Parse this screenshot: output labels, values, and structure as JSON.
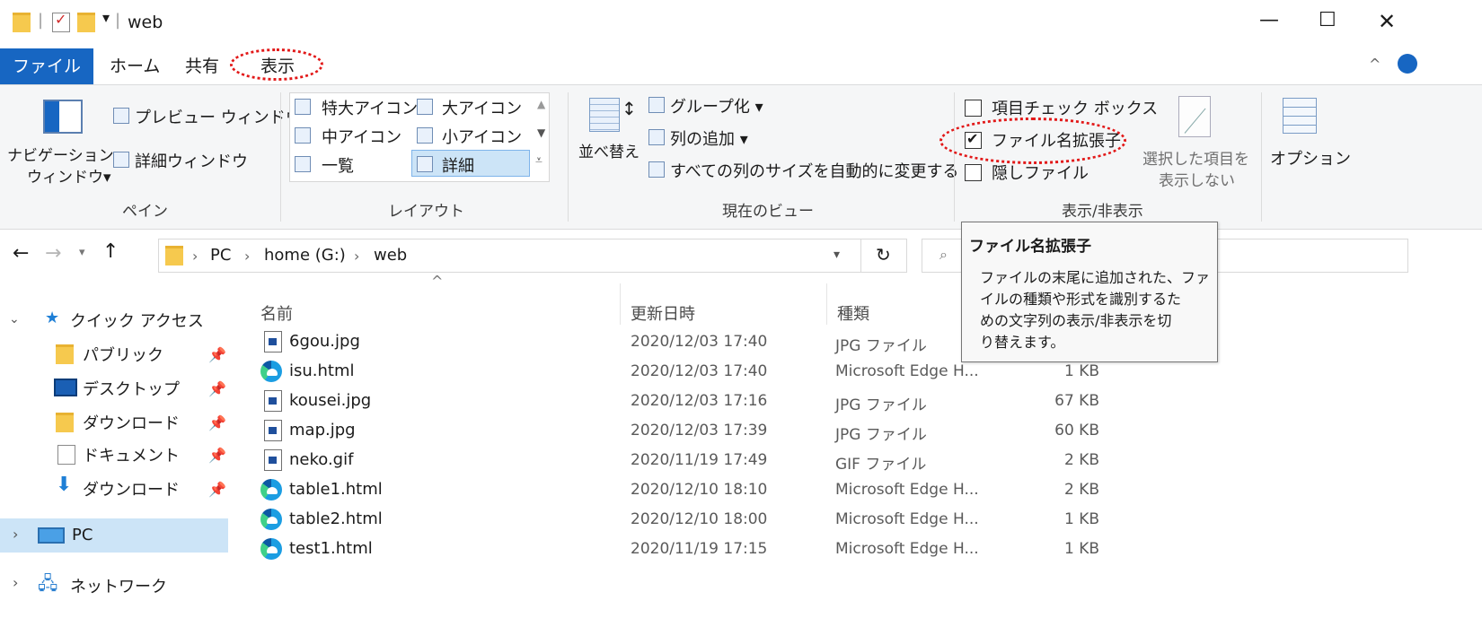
{
  "window": {
    "title": "web",
    "controls": [
      "—",
      "☐",
      "✕"
    ]
  },
  "menu": {
    "tabs": [
      "ファイル",
      "ホーム",
      "共有",
      "表示"
    ]
  },
  "ribbon": {
    "pane": {
      "nav_pane_label1": "ナビゲーション",
      "nav_pane_label2": "ウィンドウ▾",
      "preview_label": "プレビュー ウィンドウ",
      "details_label": "詳細ウィンドウ",
      "group_label": "ペイン"
    },
    "layout": {
      "items": [
        "特大アイコン",
        "大アイコン",
        "中アイコン",
        "小アイコン",
        "一覧",
        "詳細"
      ],
      "group_label": "レイアウト"
    },
    "current_view": {
      "sort_label1": "並べ替え",
      "group_by": "グループ化 ▾",
      "add_column": "列の追加 ▾",
      "autosize": "すべての列のサイズを自動的に変更する",
      "group_label": "現在のビュー"
    },
    "show_hide": {
      "item_checkbox": "項目チェック ボックス",
      "file_ext": "ファイル名拡張子",
      "hidden_files": "隠しファイル",
      "hide_selected1": "選択した項目を",
      "hide_selected2": "表示しない",
      "group_label": "表示/非表示",
      "file_ext_checked": true
    },
    "options": "オプション"
  },
  "address": {
    "path": [
      "PC",
      "home (G:)",
      "web"
    ]
  },
  "tooltip": {
    "title": "ファイル名拡張子",
    "lines": [
      "ファイルの末尾に追加された、ファ",
      "イルの種類や形式を識別するた",
      "めの文字列の表示/非表示を切",
      "り替えます。"
    ]
  },
  "nav": {
    "quick_access": "クイック アクセス",
    "items": [
      "パブリック",
      "デスクトップ",
      "ダウンロード",
      "ドキュメント",
      "ダウンロード"
    ],
    "pc": "PC",
    "network": "ネットワーク"
  },
  "columns": [
    "名前",
    "更新日時",
    "種類"
  ],
  "files": [
    {
      "name": "6gou.jpg",
      "date": "2020/12/03 17:40",
      "type": "JPG ファイル",
      "size": ""
    },
    {
      "name": "isu.html",
      "date": "2020/12/03 17:40",
      "type": "Microsoft Edge H...",
      "size": "1 KB"
    },
    {
      "name": "kousei.jpg",
      "date": "2020/12/03 17:16",
      "type": "JPG ファイル",
      "size": "67 KB"
    },
    {
      "name": "map.jpg",
      "date": "2020/12/03 17:39",
      "type": "JPG ファイル",
      "size": "60 KB"
    },
    {
      "name": "neko.gif",
      "date": "2020/11/19 17:49",
      "type": "GIF ファイル",
      "size": "2 KB"
    },
    {
      "name": "table1.html",
      "date": "2020/12/10 18:10",
      "type": "Microsoft Edge H...",
      "size": "2 KB"
    },
    {
      "name": "table2.html",
      "date": "2020/12/10 18:00",
      "type": "Microsoft Edge H...",
      "size": "1 KB"
    },
    {
      "name": "test1.html",
      "date": "2020/11/19 17:15",
      "type": "Microsoft Edge H...",
      "size": "1 KB"
    }
  ],
  "colors": {
    "accent": "#1766c2",
    "highlight": "#cce4f7",
    "annotation": "#e21818"
  }
}
